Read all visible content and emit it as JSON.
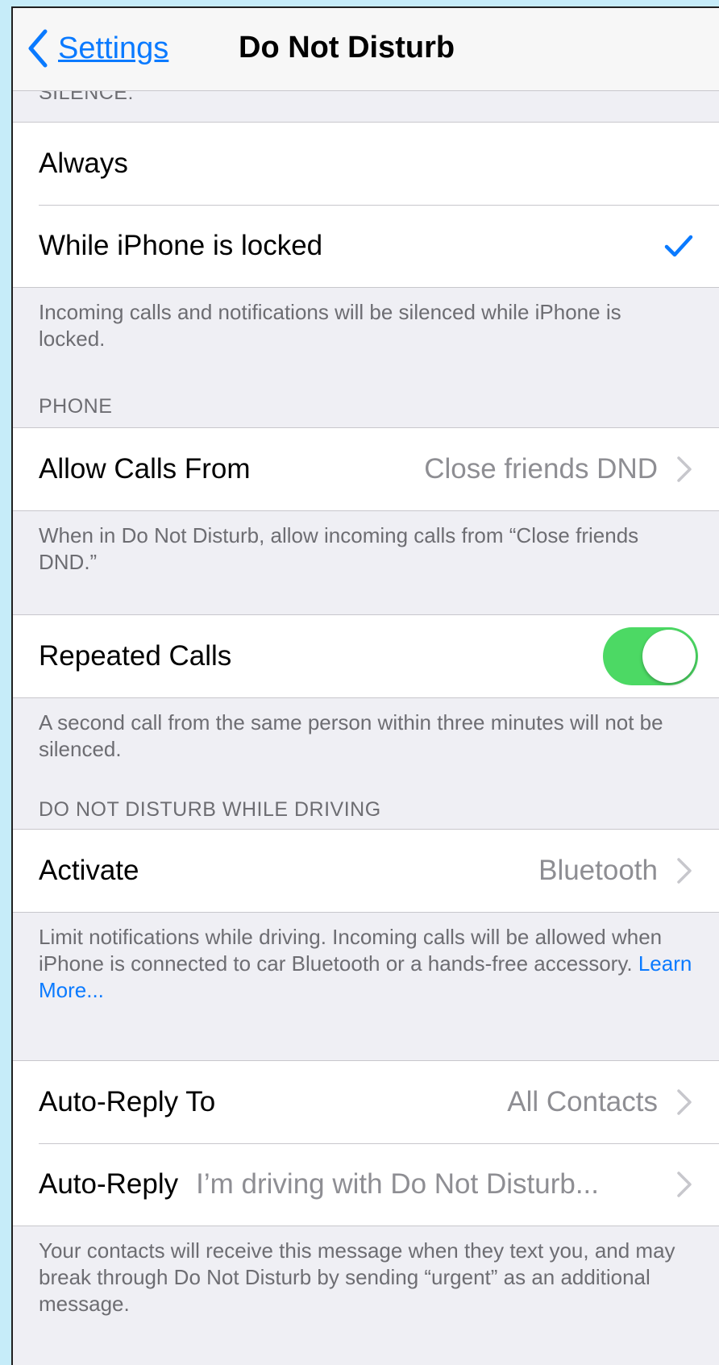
{
  "nav": {
    "back_label": "Settings",
    "title": "Do Not Disturb"
  },
  "silence": {
    "header": "SILENCE:",
    "options": [
      "Always",
      "While iPhone is locked"
    ],
    "selected": "While iPhone is locked",
    "footer": "Incoming calls and notifications will be silenced while iPhone is locked."
  },
  "phone": {
    "header": "PHONE",
    "allow_calls_label": "Allow Calls From",
    "allow_calls_value": "Close friends DND",
    "allow_calls_footer": "When in Do Not Disturb, allow incoming calls from “Close friends DND.”",
    "repeated_calls_label": "Repeated Calls",
    "repeated_calls_on": true,
    "repeated_calls_footer": "A second call from the same person within three minutes will not be silenced."
  },
  "driving": {
    "header": "DO NOT DISTURB WHILE DRIVING",
    "activate_label": "Activate",
    "activate_value": "Bluetooth",
    "footer_text": "Limit notifications while driving. Incoming calls will be allowed when iPhone is connected to car Bluetooth or a hands-free accessory.",
    "learn_more": "Learn More...",
    "auto_reply_to_label": "Auto-Reply To",
    "auto_reply_to_value": "All Contacts",
    "auto_reply_label": "Auto-Reply",
    "auto_reply_value": "I’m driving with Do Not Disturb...",
    "auto_reply_footer": "Your contacts will receive this message when they text you, and may break through Do Not Disturb by sending “urgent” as an additional message."
  },
  "colors": {
    "accent": "#0a7aff",
    "toggle_on": "#4cd964",
    "background": "#efeff4"
  },
  "icons": {
    "back": "chevron-left-icon",
    "check": "checkmark-icon",
    "disclosure": "chevron-right-icon"
  }
}
